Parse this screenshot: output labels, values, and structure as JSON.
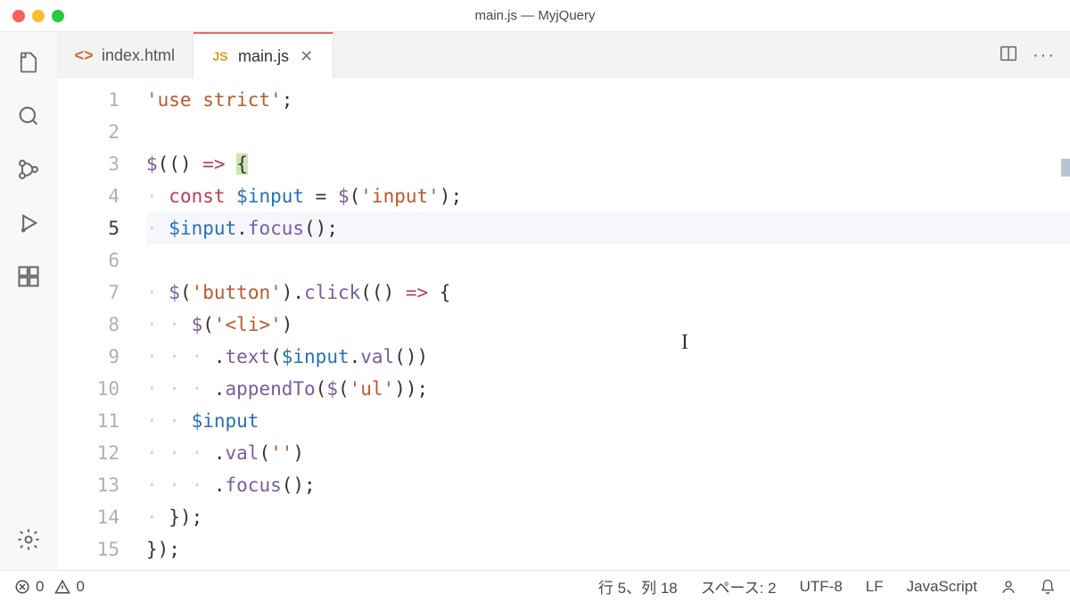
{
  "window": {
    "title": "main.js — MyjQuery"
  },
  "tabs": [
    {
      "label": "index.html",
      "icon": "html-icon"
    },
    {
      "label": "main.js",
      "icon": "js-icon"
    }
  ],
  "code": {
    "lines": [
      {
        "n": "1",
        "tokens": [
          [
            "'use strict'",
            "str"
          ],
          [
            ";",
            "pl"
          ]
        ]
      },
      {
        "n": "2",
        "tokens": []
      },
      {
        "n": "3",
        "tokens": [
          [
            "$",
            "fn"
          ],
          [
            "(() ",
            "pl"
          ],
          [
            "=>",
            "arrow"
          ],
          [
            " ",
            "pl"
          ],
          [
            "{",
            "br-hl"
          ]
        ]
      },
      {
        "n": "4",
        "tokens": [
          [
            "· ",
            "dot"
          ],
          [
            "const",
            "kw"
          ],
          [
            " ",
            "pl"
          ],
          [
            "$input",
            "var"
          ],
          [
            " = ",
            "pl"
          ],
          [
            "$",
            "fn"
          ],
          [
            "(",
            "pl"
          ],
          [
            "'input'",
            "str"
          ],
          [
            ");",
            "pl"
          ]
        ]
      },
      {
        "n": "5",
        "tokens": [
          [
            "· ",
            "dot"
          ],
          [
            "$input",
            "var"
          ],
          [
            ".",
            "pl"
          ],
          [
            "focus",
            "fn"
          ],
          [
            "();",
            "pl"
          ]
        ],
        "current": true
      },
      {
        "n": "6",
        "tokens": []
      },
      {
        "n": "7",
        "tokens": [
          [
            "· ",
            "dot"
          ],
          [
            "$",
            "fn"
          ],
          [
            "(",
            "pl"
          ],
          [
            "'button'",
            "str"
          ],
          [
            ").",
            "pl"
          ],
          [
            "click",
            "fn"
          ],
          [
            "(() ",
            "pl"
          ],
          [
            "=>",
            "arrow"
          ],
          [
            " {",
            "pl"
          ]
        ]
      },
      {
        "n": "8",
        "tokens": [
          [
            "· · ",
            "dot"
          ],
          [
            "$",
            "fn"
          ],
          [
            "(",
            "pl"
          ],
          [
            "'<li>'",
            "str"
          ],
          [
            ")",
            "pl"
          ]
        ]
      },
      {
        "n": "9",
        "tokens": [
          [
            "· · · ",
            "dot"
          ],
          [
            ".",
            "pl"
          ],
          [
            "text",
            "fn"
          ],
          [
            "(",
            "pl"
          ],
          [
            "$input",
            "var"
          ],
          [
            ".",
            "pl"
          ],
          [
            "val",
            "fn"
          ],
          [
            "())",
            "pl"
          ]
        ]
      },
      {
        "n": "10",
        "tokens": [
          [
            "· · · ",
            "dot"
          ],
          [
            ".",
            "pl"
          ],
          [
            "appendTo",
            "fn"
          ],
          [
            "(",
            "pl"
          ],
          [
            "$",
            "fn"
          ],
          [
            "(",
            "pl"
          ],
          [
            "'ul'",
            "str"
          ],
          [
            "));",
            "pl"
          ]
        ]
      },
      {
        "n": "11",
        "tokens": [
          [
            "· · ",
            "dot"
          ],
          [
            "$input",
            "var"
          ]
        ]
      },
      {
        "n": "12",
        "tokens": [
          [
            "· · · ",
            "dot"
          ],
          [
            ".",
            "pl"
          ],
          [
            "val",
            "fn"
          ],
          [
            "(",
            "pl"
          ],
          [
            "''",
            "str"
          ],
          [
            ")",
            "pl"
          ]
        ]
      },
      {
        "n": "13",
        "tokens": [
          [
            "· · · ",
            "dot"
          ],
          [
            ".",
            "pl"
          ],
          [
            "focus",
            "fn"
          ],
          [
            "();",
            "pl"
          ]
        ]
      },
      {
        "n": "14",
        "tokens": [
          [
            "· ",
            "dot"
          ],
          [
            "});",
            "pl"
          ]
        ]
      },
      {
        "n": "15",
        "tokens": [
          [
            "});",
            "pl"
          ]
        ]
      }
    ]
  },
  "status": {
    "errors": "0",
    "warnings": "0",
    "cursor": "行 5、列 18",
    "indent": "スペース: 2",
    "encoding": "UTF-8",
    "eol": "LF",
    "language": "JavaScript"
  },
  "icons": {
    "js_glyph": "JS",
    "html_glyph": "<>"
  }
}
